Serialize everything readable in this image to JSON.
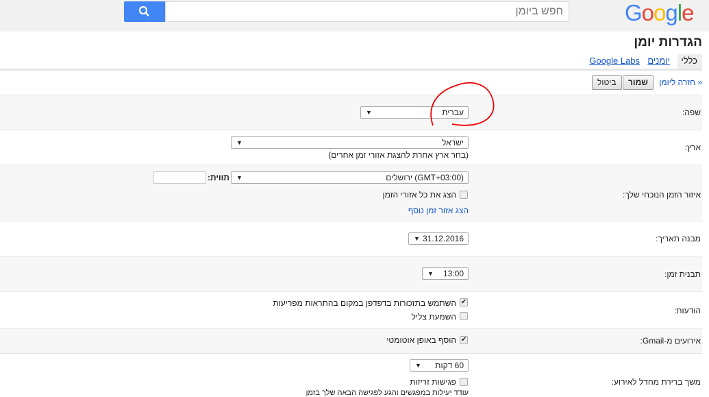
{
  "header": {
    "search_placeholder": "חפש ביומן",
    "logo": "Google"
  },
  "page_title": "הגדרות יומן",
  "tabs": [
    {
      "label": "כללי"
    },
    {
      "label": "יומנים"
    },
    {
      "label": "Google Labs"
    }
  ],
  "toolbar": {
    "back": "« חזרה ליומן",
    "save": "שמור",
    "cancel": "ביטול"
  },
  "settings": {
    "language": {
      "label": "שפה:",
      "value": "עברית"
    },
    "country": {
      "label": "ארץ:",
      "value": "ישראל",
      "hint": "(בחר ארץ אחרת להצגת אזורי זמן אחרים)"
    },
    "timezone": {
      "label": "איזור הזמן הנוכחי שלך:",
      "value": "(GMT+03:00) ירושלים",
      "tag_label": "תווית:",
      "tag_value": "",
      "show_all": "הצג את כל אזורי הזמן",
      "show_all_checked": false,
      "add_link": "הצג אזור זמן נוסף"
    },
    "date_format": {
      "label": "מבנה תאריך:",
      "value": "31.12.2016"
    },
    "time_format": {
      "label": "תבנית זמן:",
      "value": "13:00"
    },
    "notifications": {
      "label": "הודעות:",
      "browser": "השתמש בתזכורות בדפדפן במקום בהתראות מפריעות",
      "browser_checked": true,
      "sound": "השמעת צליל",
      "sound_checked": false
    },
    "gmail": {
      "label": "אירועים מ-Gmail:",
      "auto": "הוסף באופן אוטומטי",
      "auto_checked": true
    },
    "duration": {
      "label": "משך ברירת מחדל לאירוע:",
      "value": "60 דקות",
      "speedy": "פגישות זריזות",
      "speedy_checked": false,
      "hint": "עודד יעילות במפגשים והגע לפגישה הבאה שלך בזמן"
    }
  }
}
